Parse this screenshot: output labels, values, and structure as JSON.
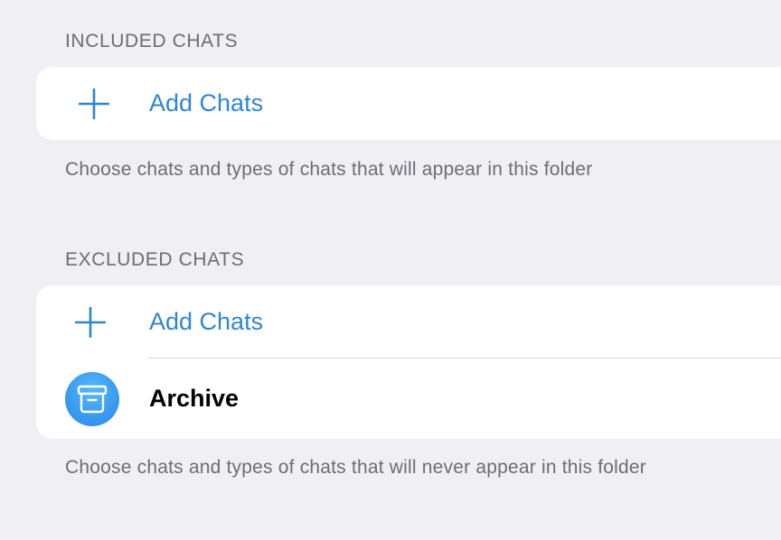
{
  "included": {
    "header": "INCLUDED CHATS",
    "add_label": "Add Chats",
    "footer": "Choose chats and types of chats that will appear in this folder"
  },
  "excluded": {
    "header": "EXCLUDED CHATS",
    "add_label": "Add Chats",
    "archive_label": "Archive",
    "footer": "Choose chats and types of chats that will never appear in this folder"
  },
  "colors": {
    "background": "#efeff4",
    "accent": "#2f86d1",
    "secondary_text": "#6d6d72",
    "archive_avatar": "#3a9cf0"
  },
  "icons": {
    "add": "plus-icon",
    "archive": "archive-box-icon"
  }
}
